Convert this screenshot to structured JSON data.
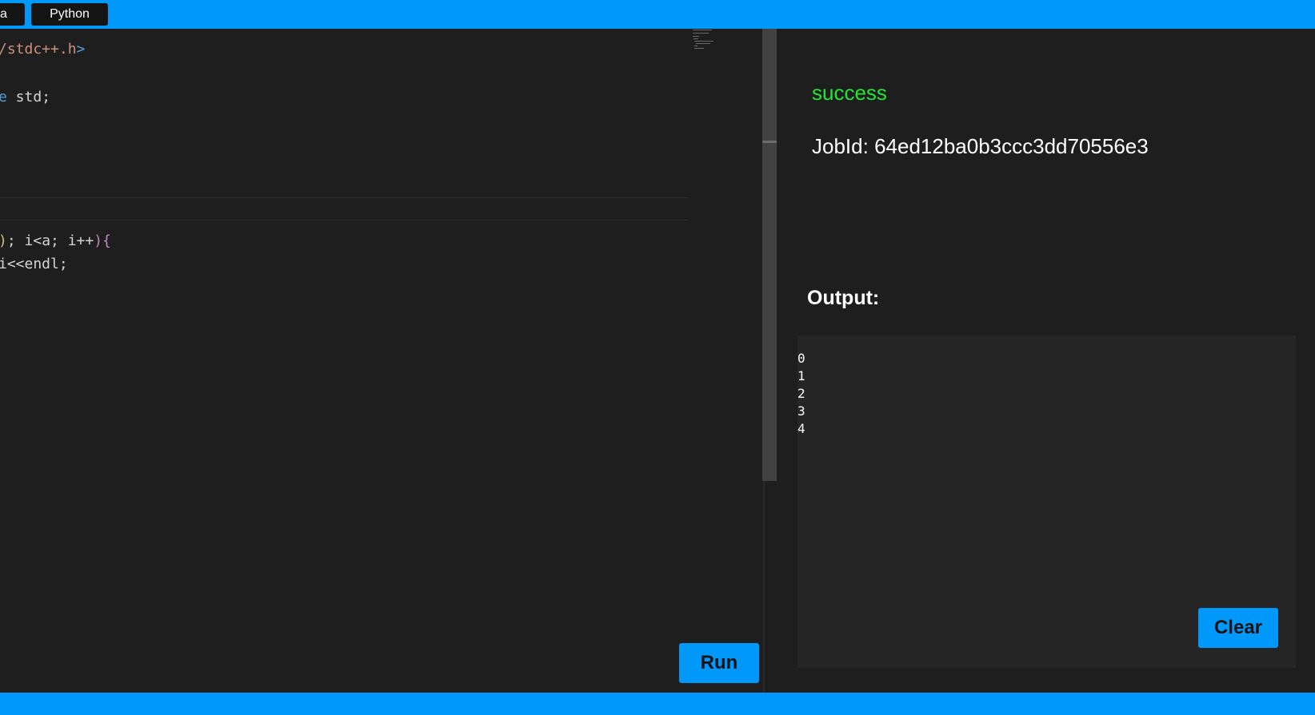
{
  "top_bar": {
    "tabs": [
      {
        "label": "a"
      },
      {
        "label": "Python"
      }
    ]
  },
  "editor": {
    "lines": [
      {
        "a": "/stdc++.h",
        "b": ">"
      },
      {
        "a": "e",
        "b": " std;"
      },
      {
        "a": ")",
        "b": "; i<a; i++",
        "c": "){"
      },
      {
        "a": "i<<endl;"
      }
    ],
    "run_label": "Run"
  },
  "result": {
    "status": "success",
    "jobid_label": "JobId:",
    "jobid_value": "64ed12ba0b3ccc3dd70556e3",
    "output_label": "Output:",
    "output_lines": [
      "0",
      "1",
      "2",
      "3",
      "4"
    ],
    "clear_label": "Clear"
  },
  "colors": {
    "accent": "#0098fa",
    "success": "#22e532",
    "editor_background": "#1e1e1e",
    "output_background": "#252525"
  }
}
